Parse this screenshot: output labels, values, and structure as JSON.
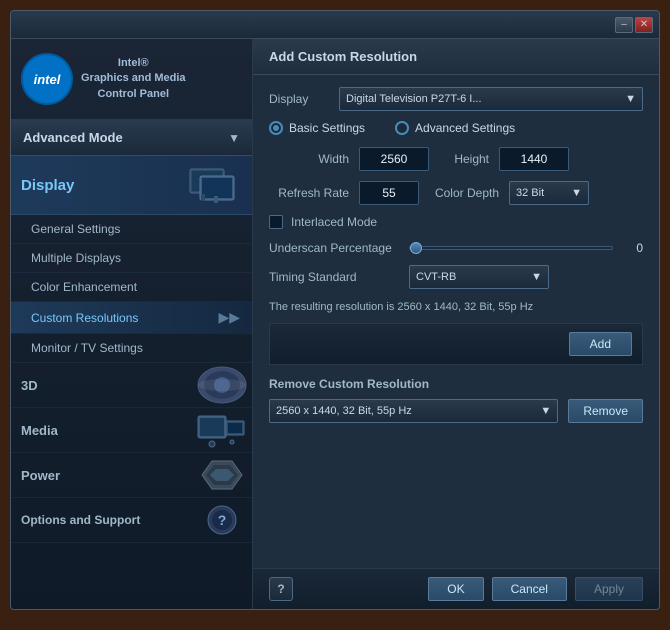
{
  "window": {
    "title": "Intel® Graphics and Media Control Panel"
  },
  "titlebar": {
    "minimize_label": "–",
    "close_label": "✕"
  },
  "sidebar": {
    "logo_text": "intel",
    "app_title_line1": "Intel®",
    "app_title_line2": "Graphics and Media",
    "app_title_line3": "Control Panel",
    "advanced_mode_label": "Advanced Mode",
    "display_label": "Display",
    "nav_items": [
      {
        "label": "General Settings",
        "active": false
      },
      {
        "label": "Multiple Displays",
        "active": false
      },
      {
        "label": "Color Enhancement",
        "active": false
      },
      {
        "label": "Custom Resolutions",
        "active": true
      },
      {
        "label": "Monitor / TV Settings",
        "active": false
      }
    ],
    "section_items": [
      {
        "label": "3D",
        "has_icon": true
      },
      {
        "label": "Media",
        "has_icon": true
      },
      {
        "label": "Power",
        "has_icon": true
      },
      {
        "label": "Options and Support",
        "has_icon": true
      }
    ]
  },
  "panel": {
    "title": "Add Custom Resolution",
    "display_label": "Display",
    "display_value": "Digital Television P27T-6 I...",
    "radio_basic_label": "Basic Settings",
    "radio_advanced_label": "Advanced Settings",
    "width_label": "Width",
    "width_value": "2560",
    "height_label": "Height",
    "height_value": "1440",
    "refresh_rate_label": "Refresh Rate",
    "refresh_rate_value": "55",
    "color_depth_label": "Color Depth",
    "color_depth_value": "32 Bit",
    "interlaced_label": "Interlaced Mode",
    "underscan_label": "Underscan Percentage",
    "underscan_value": "0",
    "timing_label": "Timing Standard",
    "timing_value": "CVT-RB",
    "result_text": "The resulting resolution is 2560 x 1440, 32 Bit, 55p Hz",
    "add_btn_label": "Add",
    "remove_section_title": "Remove Custom Resolution",
    "remove_select_value": "2560 x 1440, 32 Bit, 55p Hz",
    "remove_btn_label": "Remove"
  },
  "bottombar": {
    "help_label": "?",
    "ok_label": "OK",
    "cancel_label": "Cancel",
    "apply_label": "Apply"
  }
}
